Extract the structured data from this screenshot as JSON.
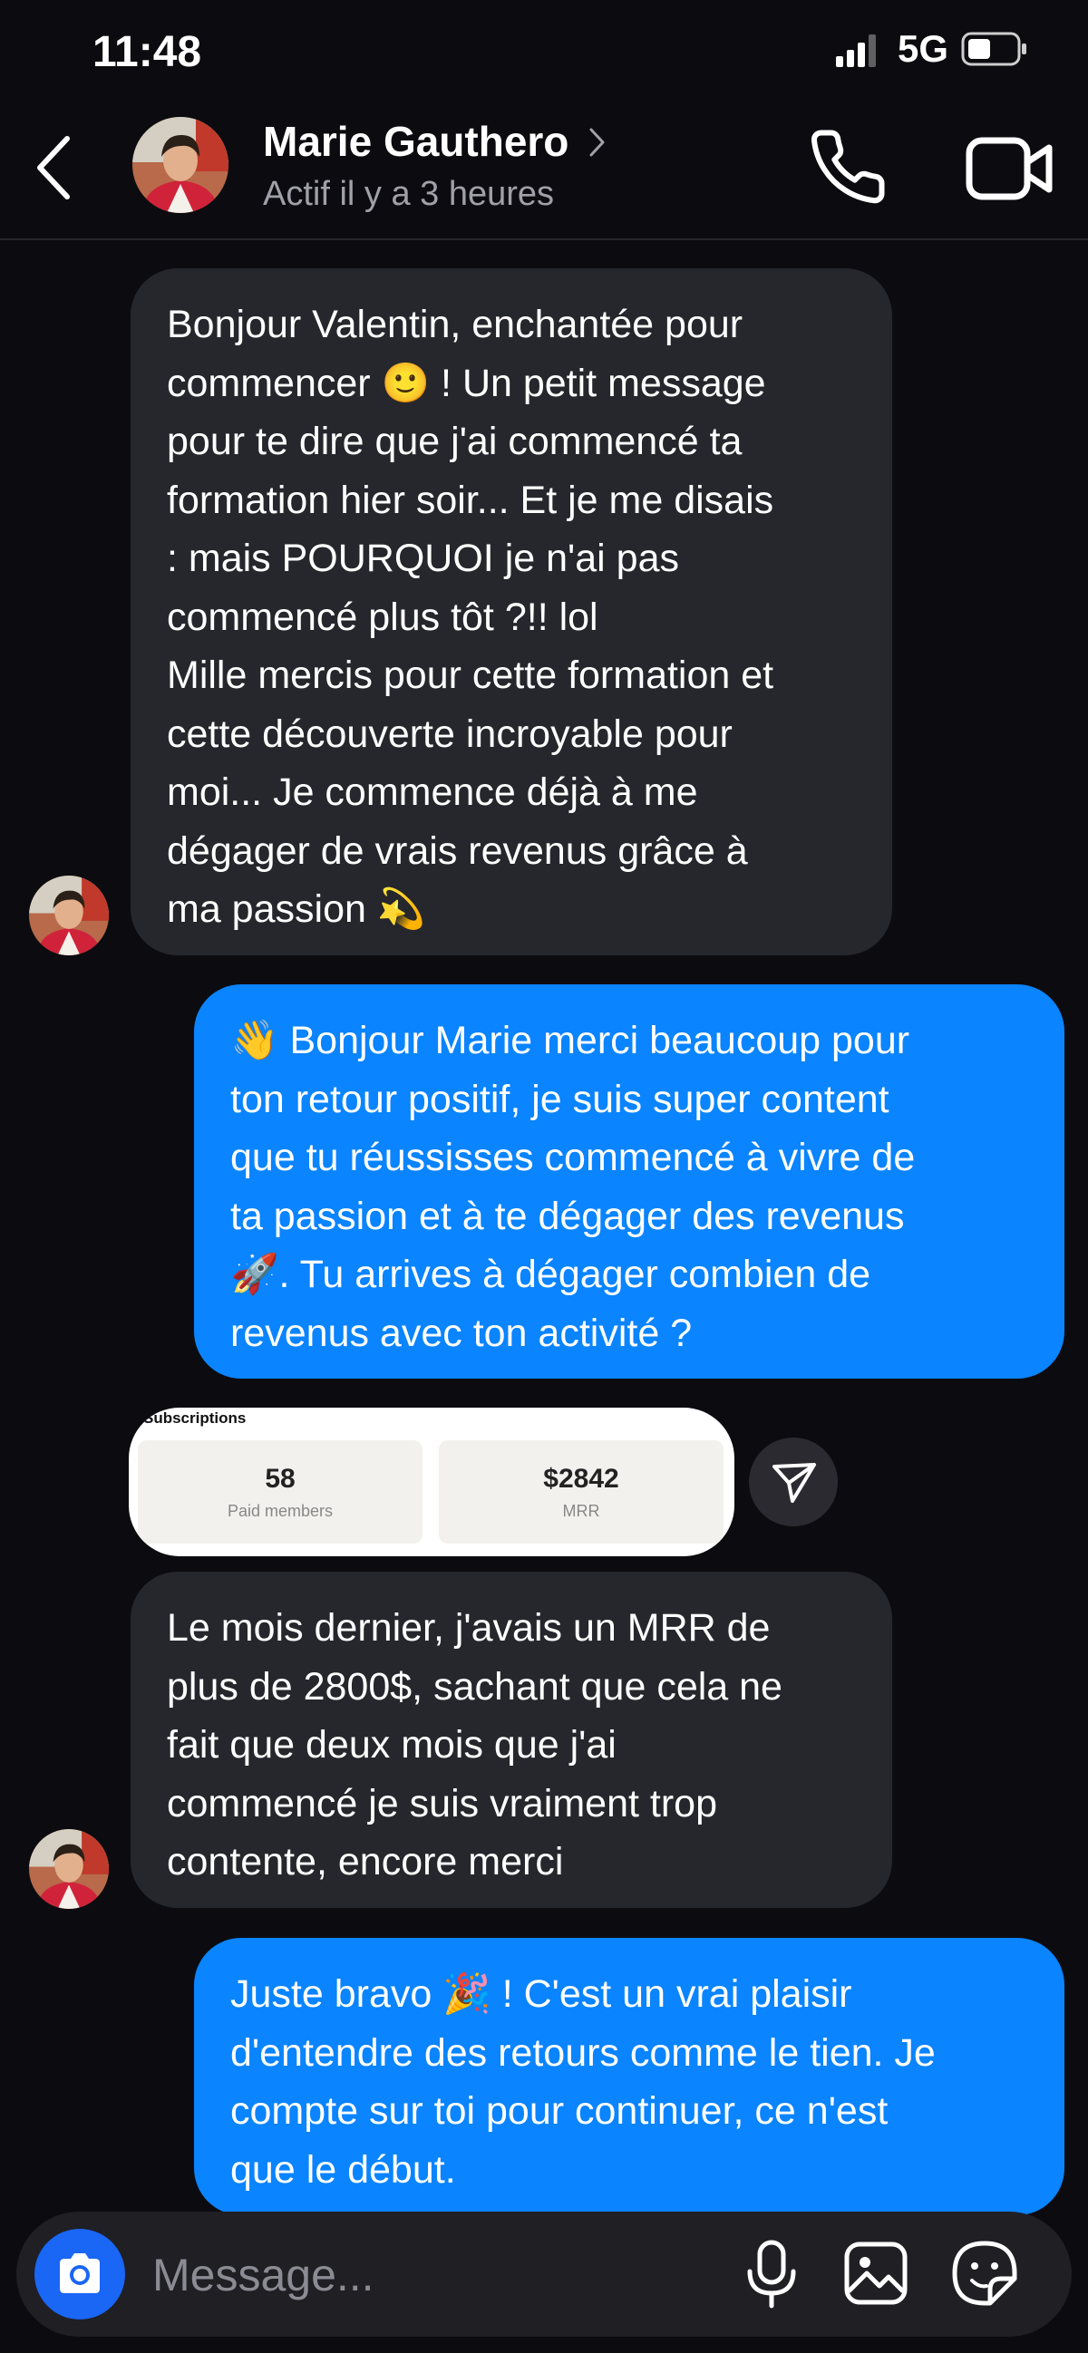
{
  "status_bar": {
    "time": "11:48",
    "network": "5G"
  },
  "header": {
    "contact_name": "Marie Gauthero",
    "contact_status": "Actif il y a 3 heures"
  },
  "messages": [
    {
      "direction": "incoming",
      "text": "Bonjour Valentin, enchantée pour\ncommencer 🙂 ! Un petit message\npour te dire que j'ai commencé ta\nformation hier soir... Et je me disais\n: mais POURQUOI je n'ai pas\ncommencé plus tôt ?!! lol\nMille mercis pour cette formation et\ncette découverte incroyable pour\nmoi... Je commence déjà à me\ndégager de vrais revenus grâce à\nma passion 💫"
    },
    {
      "direction": "outgoing",
      "text": "👋 Bonjour Marie merci beaucoup pour\nton retour positif, je suis super content\nque tu réussisses commencé à vivre de\nta passion et à te dégager des revenus\n🚀. Tu arrives à dégager combien de\nrevenus avec ton activité ?"
    },
    {
      "direction": "incoming",
      "text": "Le mois dernier, j'avais un MRR de\nplus de 2800$, sachant que cela ne\nfait que deux mois que j'ai\ncommencé je suis vraiment trop\ncontente, encore merci"
    },
    {
      "direction": "outgoing",
      "text": "Juste bravo 🎉 ! C'est un vrai plaisir\nd'entendre des retours comme le tien. Je\ncompte sur toi pour continuer, ce n'est\nque le début."
    }
  ],
  "image_attachment": {
    "title": "Subscriptions",
    "stats": [
      {
        "value": "58",
        "label": "Paid members"
      },
      {
        "value": "$2842",
        "label": "MRR"
      }
    ]
  },
  "composer": {
    "placeholder": "Message..."
  },
  "icons": {
    "back": "back-arrow-icon",
    "call": "phone-icon",
    "video": "video-camera-icon",
    "share": "send-icon",
    "camera": "camera-icon",
    "mic": "microphone-icon",
    "gallery": "image-gallery-icon",
    "sticker": "sticker-icon"
  },
  "colors": {
    "background": "#0c0c10",
    "incoming_bubble": "#26272c",
    "outgoing_bubble": "#0a84ff",
    "camera_button": "#1a66f5"
  }
}
